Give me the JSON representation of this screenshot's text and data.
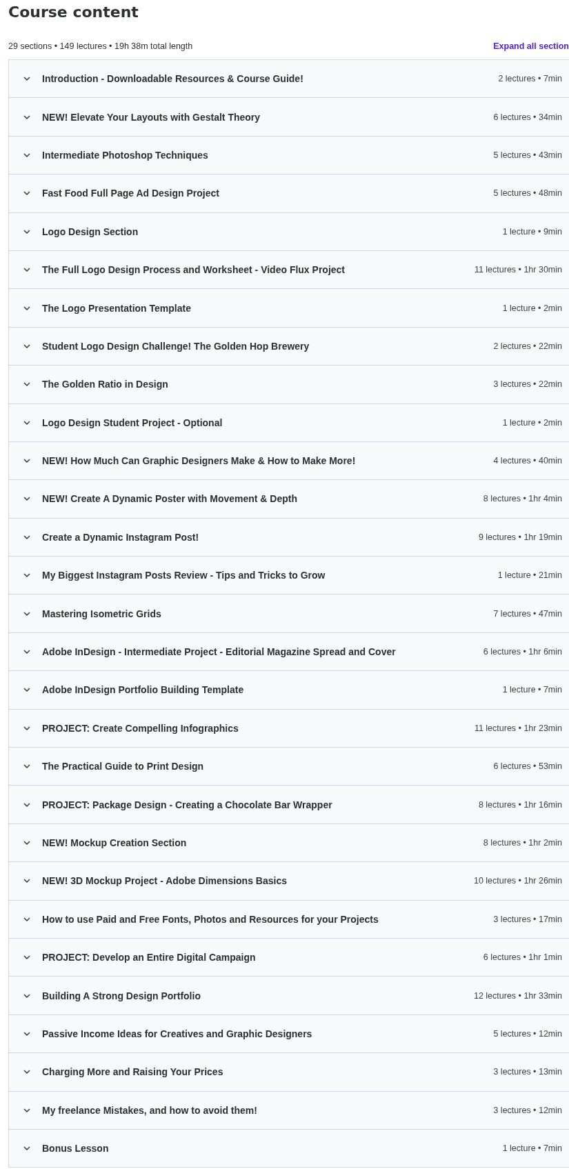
{
  "title": "Course content",
  "summary": "29 sections • 149 lectures • 19h 38m total length",
  "expand_link": "Expand all section",
  "sections": [
    {
      "title": "Introduction - Downloadable Resources & Course Guide!",
      "meta": "2 lectures • 7min",
      "expanded": false
    },
    {
      "title": "NEW! Elevate Your Layouts with Gestalt Theory",
      "meta": "6 lectures • 34min",
      "expanded": false
    },
    {
      "title": "Intermediate Photoshop Techniques",
      "meta": "5 lectures • 43min",
      "expanded": false
    },
    {
      "title": "Fast Food Full Page Ad Design Project",
      "meta": "5 lectures • 48min",
      "expanded": false
    },
    {
      "title": "Logo Design Section",
      "meta": "1 lecture • 9min",
      "expanded": false
    },
    {
      "title": "The Full Logo Design Process and Worksheet - Video Flux Project",
      "meta": "11 lectures • 1hr 30min",
      "expanded": false
    },
    {
      "title": "The Logo Presentation Template",
      "meta": "1 lecture • 2min",
      "expanded": false
    },
    {
      "title": "Student Logo Design Challenge! The Golden Hop Brewery",
      "meta": "2 lectures • 22min",
      "expanded": false
    },
    {
      "title": "The Golden Ratio in Design",
      "meta": "3 lectures • 22min",
      "expanded": false
    },
    {
      "title": "Logo Design Student Project - Optional",
      "meta": "1 lecture • 2min",
      "expanded": false
    },
    {
      "title": "NEW! How Much Can Graphic Designers Make & How to Make More!",
      "meta": "4 lectures • 40min",
      "expanded": false
    },
    {
      "title": "NEW! Create A Dynamic Poster with Movement & Depth",
      "meta": "8 lectures • 1hr 4min",
      "expanded": false
    },
    {
      "title": "Create a Dynamic Instagram Post!",
      "meta": "9 lectures • 1hr 19min",
      "expanded": false
    },
    {
      "title": "My Biggest Instagram Posts Review - Tips and Tricks to Grow",
      "meta": "1 lecture • 21min",
      "expanded": false
    },
    {
      "title": "Mastering Isometric Grids",
      "meta": "7 lectures • 47min",
      "expanded": false
    },
    {
      "title": "Adobe InDesign - Intermediate Project - Editorial Magazine Spread and Cover",
      "meta": "6 lectures • 1hr 6min",
      "expanded": false
    },
    {
      "title": "Adobe InDesign Portfolio Building Template",
      "meta": "1 lecture • 7min",
      "expanded": false
    },
    {
      "title": "PROJECT: Create Compelling Infographics",
      "meta": "11 lectures • 1hr 23min",
      "expanded": false
    },
    {
      "title": "The Practical Guide to Print Design",
      "meta": "6 lectures • 53min",
      "expanded": false
    },
    {
      "title": "PROJECT: Package Design - Creating a Chocolate Bar Wrapper",
      "meta": "8 lectures • 1hr 16min",
      "expanded": false
    },
    {
      "title": "NEW! Mockup Creation Section",
      "meta": "8 lectures • 1hr 2min",
      "expanded": false
    },
    {
      "title": "NEW! 3D Mockup Project - Adobe Dimensions Basics",
      "meta": "10 lectures • 1hr 26min",
      "expanded": false
    },
    {
      "title": "How to use Paid and Free Fonts, Photos and Resources for your Projects",
      "meta": "3 lectures • 17min",
      "expanded": false
    },
    {
      "title": "PROJECT: Develop an Entire Digital Campaign",
      "meta": "6 lectures • 1hr 1min",
      "expanded": false
    },
    {
      "title": "Building A Strong Design Portfolio",
      "meta": "12 lectures • 1hr 33min",
      "expanded": false
    },
    {
      "title": "Passive Income Ideas for Creatives and Graphic Designers",
      "meta": "5 lectures • 12min",
      "expanded": false
    },
    {
      "title": "Charging More and Raising Your Prices",
      "meta": "3 lectures • 13min",
      "expanded": false
    },
    {
      "title": "My freelance Mistakes, and how to avoid them!",
      "meta": "3 lectures • 12min",
      "expanded": false
    },
    {
      "title": "Bonus Lesson",
      "meta": "1 lecture • 7min",
      "expanded": false
    }
  ]
}
